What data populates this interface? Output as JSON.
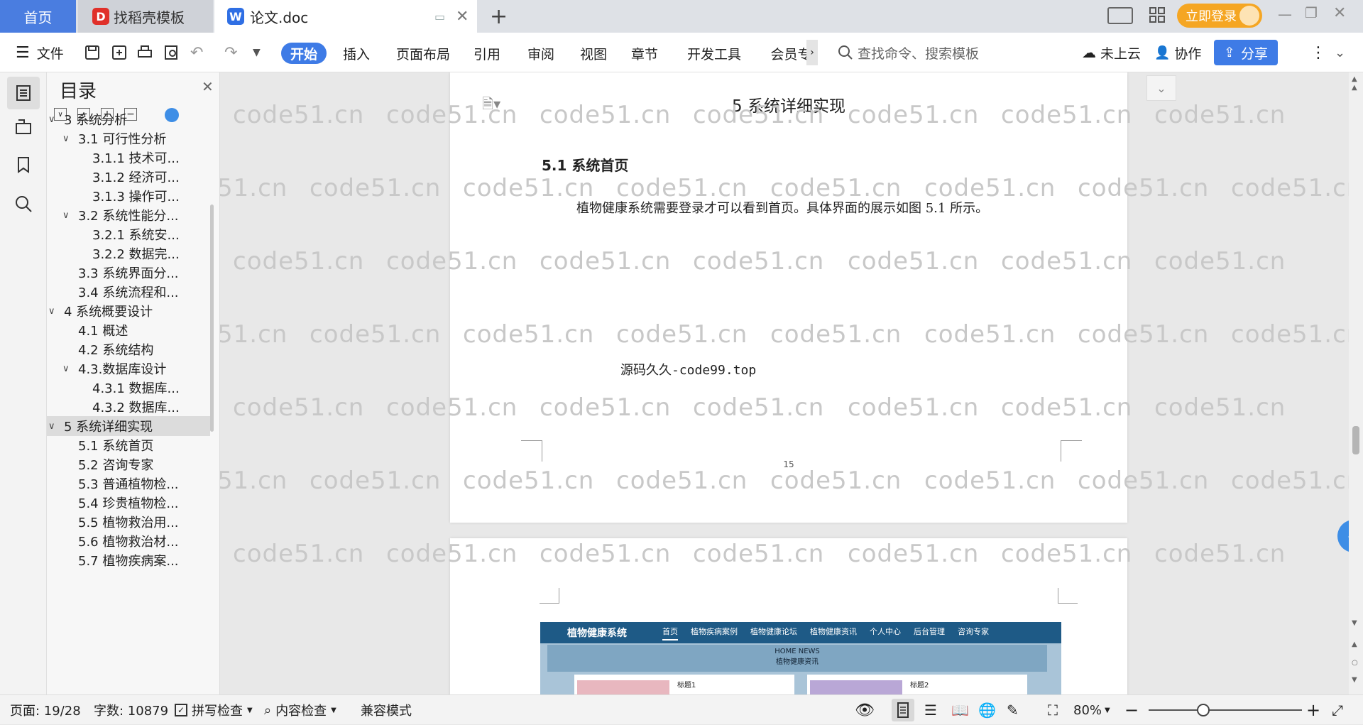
{
  "tabs": {
    "home": "首页",
    "find": "找稻壳模板",
    "doc": "论文.doc",
    "login_btn": "立即登录"
  },
  "toolbar": {
    "file": "文件",
    "menus": [
      "开始",
      "插入",
      "页面布局",
      "引用",
      "审阅",
      "视图",
      "章节",
      "开发工具",
      "会员专"
    ],
    "search_placeholder": "查找命令、搜索模板",
    "cloud": "未上云",
    "collab": "协作",
    "share": "分享"
  },
  "toc": {
    "title": "目录",
    "items": [
      {
        "label": "3 系统分析",
        "level": 1,
        "caret": true
      },
      {
        "label": "3.1 可行性分析",
        "level": 2,
        "caret": true
      },
      {
        "label": "3.1.1 技术可...",
        "level": 3,
        "caret": false
      },
      {
        "label": "3.1.2 经济可...",
        "level": 3,
        "caret": false
      },
      {
        "label": "3.1.3 操作可...",
        "level": 3,
        "caret": false
      },
      {
        "label": "3.2 系统性能分...",
        "level": 2,
        "caret": true
      },
      {
        "label": "3.2.1  系统安...",
        "level": 3,
        "caret": false
      },
      {
        "label": "3.2.2  数据完...",
        "level": 3,
        "caret": false
      },
      {
        "label": "3.3 系统界面分...",
        "level": 2,
        "caret": false
      },
      {
        "label": "3.4 系统流程和...",
        "level": 2,
        "caret": false
      },
      {
        "label": "4 系统概要设计",
        "level": 1,
        "caret": true
      },
      {
        "label": "4.1 概述",
        "level": 2,
        "caret": false
      },
      {
        "label": "4.2 系统结构",
        "level": 2,
        "caret": false
      },
      {
        "label": "4.3.数据库设计",
        "level": 2,
        "caret": true
      },
      {
        "label": "4.3.1 数据库...",
        "level": 3,
        "caret": false
      },
      {
        "label": "4.3.2 数据库...",
        "level": 3,
        "caret": false
      },
      {
        "label": "5 系统详细实现",
        "level": 1,
        "caret": true,
        "selected": true
      },
      {
        "label": "5.1  系统首页",
        "level": 2,
        "caret": false
      },
      {
        "label": "5.2  咨询专家",
        "level": 2,
        "caret": false
      },
      {
        "label": "5.3  普通植物检...",
        "level": 2,
        "caret": false
      },
      {
        "label": "5.4  珍贵植物检...",
        "level": 2,
        "caret": false
      },
      {
        "label": "5.5  植物救治用...",
        "level": 2,
        "caret": false
      },
      {
        "label": "5.6  植物救治材...",
        "level": 2,
        "caret": false
      },
      {
        "label": "5.7  植物疾病案...",
        "level": 2,
        "caret": false
      }
    ]
  },
  "document": {
    "chapter_title": "5 系统详细实现",
    "section_title": "5.1  系统首页",
    "paragraph": "植物健康系统需要登录才可以看到首页。具体界面的展示如图 5.1 所示。",
    "source_note": "源码久久-code99.top",
    "page_number": "15",
    "watermark": "code51.cn"
  },
  "embedded_site": {
    "brand": "植物健康系统",
    "nav": [
      "首页",
      "植物疾病案例",
      "植物健康论坛",
      "植物健康资讯",
      "个人中心",
      "后台管理",
      "咨询专家"
    ],
    "banner_en": "HOME NEWS",
    "banner_cn": "植物健康资讯",
    "card1": "标题1",
    "card2": "标题2",
    "header_color": "#1e5a86"
  },
  "status": {
    "page": "页面: 19/28",
    "words": "字数: 10879",
    "spell": "拼写检查",
    "content_check": "内容检查",
    "compat": "兼容模式",
    "zoom": "80%"
  },
  "colors": {
    "accent": "#3e7be6",
    "login": "#f5a623"
  }
}
